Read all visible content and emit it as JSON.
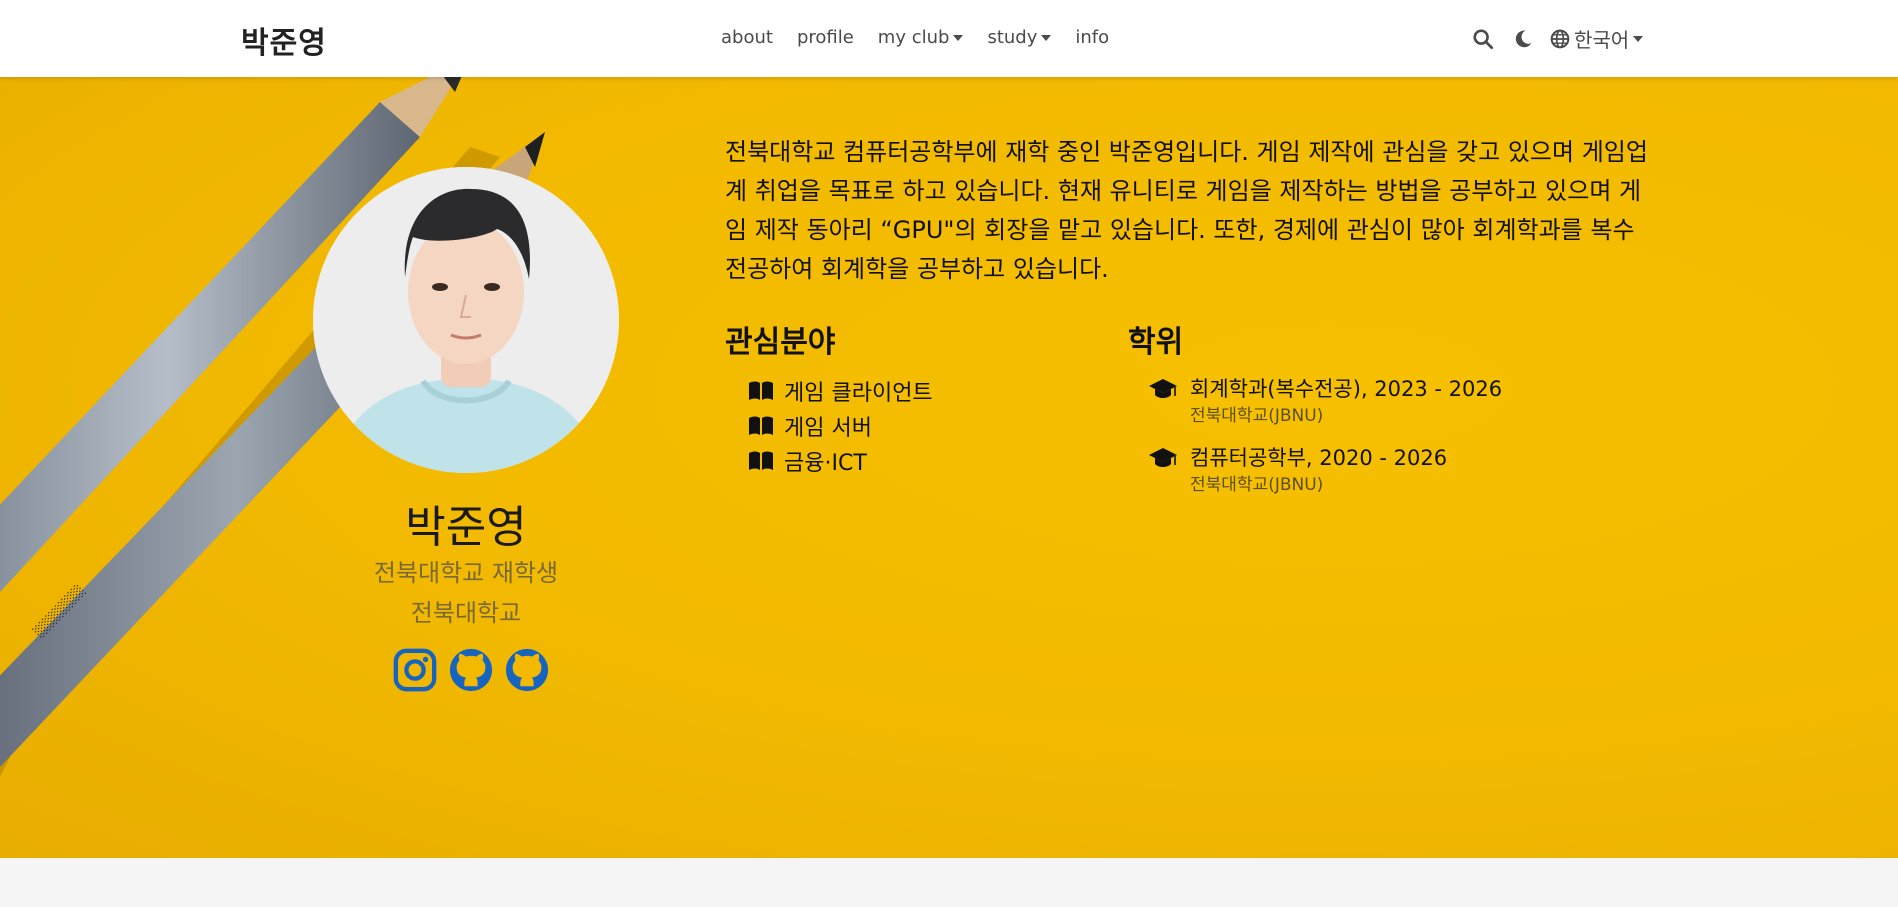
{
  "navbar": {
    "brand": "박준영",
    "links": [
      {
        "label": "about",
        "dropdown": false
      },
      {
        "label": "profile",
        "dropdown": false
      },
      {
        "label": "my club",
        "dropdown": true
      },
      {
        "label": "study",
        "dropdown": true
      },
      {
        "label": "info",
        "dropdown": false
      }
    ],
    "language": "한국어",
    "icons": [
      "search-icon",
      "moon-icon",
      "globe-icon"
    ]
  },
  "profile": {
    "name": "박준영",
    "role": "전북대학교 재학생",
    "organization": "전북대학교",
    "socials": [
      "instagram-icon",
      "github-icon",
      "github-icon"
    ],
    "social_color": "#1565c0"
  },
  "bio": "전북대학교 컴퓨터공학부에 재학 중인 박준영입니다. 게임 제작에 관심을 갖고 있으며 게임업계 취업을 목표로 하고 있습니다. 현재 유니티로 게임을 제작하는 방법을 공부하고 있으며 게임 제작 동아리 “GPU\"의 회장을 맡고 있습니다. 또한, 경제에 관심이 많아 회계학과를 복수전공하여 회계학을 공부하고 있습니다.",
  "interests": {
    "title": "관심분야",
    "items": [
      "게임 클라이언트",
      "게임 서버",
      "금융·ICT"
    ]
  },
  "education": {
    "title": "학위",
    "items": [
      {
        "course": "회계학과(복수전공), 2023 - 2026",
        "institution": "전북대학교(JBNU)"
      },
      {
        "course": "컴퓨터공학부, 2020 - 2026",
        "institution": "전북대학교(JBNU)"
      }
    ]
  },
  "colors": {
    "hero_background": "#f4bb00",
    "nav_background": "#ffffff",
    "text": "#111111",
    "muted": "#7a6a3a"
  }
}
